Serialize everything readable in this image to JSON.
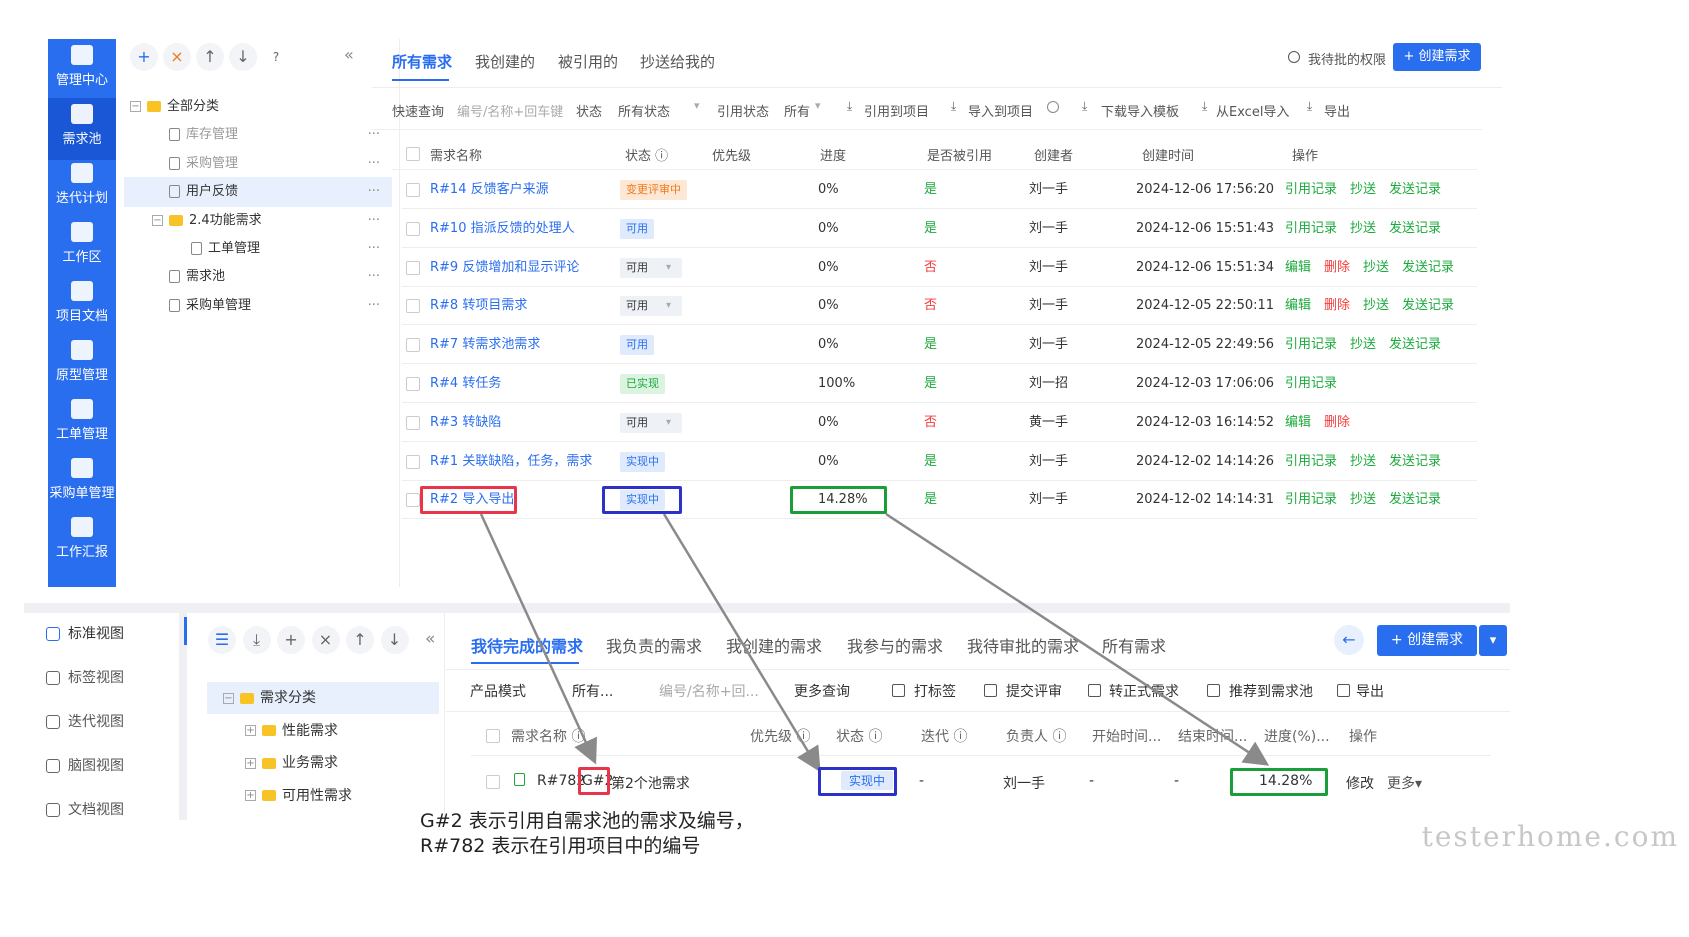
{
  "top": {
    "nav": [
      {
        "label": "管理中心",
        "icon": "monitor-icon"
      },
      {
        "label": "需求池",
        "icon": "doc-edit-icon",
        "active": true
      },
      {
        "label": "迭代计划",
        "icon": "iteration-icon"
      },
      {
        "label": "工作区",
        "icon": "briefcase-icon"
      },
      {
        "label": "项目文档",
        "icon": "document-icon"
      },
      {
        "label": "原型管理",
        "icon": "prototype-icon"
      },
      {
        "label": "工单管理",
        "icon": "ticket-icon"
      },
      {
        "label": "采购单管理",
        "icon": "purchase-icon"
      },
      {
        "label": "工作汇报",
        "icon": "mail-icon"
      }
    ],
    "toolbar_icons": [
      "+",
      "×",
      "↑",
      "↓",
      "?"
    ],
    "collapse": "«",
    "tree": [
      {
        "label": "全部分类",
        "type": "folder",
        "level": 0,
        "expand": "−"
      },
      {
        "label": "库存管理",
        "type": "doc",
        "level": 1,
        "muted": true
      },
      {
        "label": "采购管理",
        "type": "doc",
        "level": 1,
        "muted": true
      },
      {
        "label": "用户反馈",
        "type": "doc",
        "level": 1,
        "selected": true
      },
      {
        "label": "2.4功能需求",
        "type": "folder",
        "level": 1,
        "expand": "−"
      },
      {
        "label": "工单管理",
        "type": "doc",
        "level": 2
      },
      {
        "label": "需求池",
        "type": "doc",
        "level": 1
      },
      {
        "label": "采购单管理",
        "type": "doc",
        "level": 1
      }
    ],
    "tabs": [
      "所有需求",
      "我创建的",
      "被引用的",
      "抄送给我的"
    ],
    "permission": "我待批的权限",
    "create": "+ 创建需求",
    "filters": {
      "quick": "快速查询",
      "search_placeholder": "编号/名称+回车键",
      "status_label": "状态",
      "status_value": "所有状态",
      "ref_label": "引用状态",
      "ref_value": "所有",
      "cite": "引用到项目",
      "import_project": "导入到项目",
      "download_tpl": "下载导入模板",
      "excel": "从Excel导入",
      "export": "导出"
    },
    "columns": [
      "需求名称",
      "状态 ⓘ",
      "优先级",
      "进度",
      "是否被引用",
      "创建者",
      "创建时间",
      "操作"
    ],
    "rows": [
      {
        "name": "R#14 反馈客户来源",
        "status": "变更评审中",
        "status_color": "orange",
        "drop": false,
        "progress": "0%",
        "ref": "是",
        "creator": "刘一手",
        "time": "2024-12-06 17:56:20",
        "ops": [
          "引用记录",
          "抄送",
          "发送记录"
        ]
      },
      {
        "name": "R#10 指派反馈的处理人",
        "status": "可用",
        "status_color": "blue",
        "drop": false,
        "progress": "0%",
        "ref": "是",
        "creator": "刘一手",
        "time": "2024-12-06 15:51:43",
        "ops": [
          "引用记录",
          "抄送",
          "发送记录"
        ]
      },
      {
        "name": "R#9 反馈增加和显示评论",
        "status": "可用",
        "status_color": "drop",
        "drop": true,
        "progress": "0%",
        "ref": "否",
        "creator": "刘一手",
        "time": "2024-12-06 15:51:34",
        "ops": [
          "编辑",
          "删除",
          "抄送",
          "发送记录"
        ]
      },
      {
        "name": "R#8 转项目需求",
        "status": "可用",
        "status_color": "drop",
        "drop": true,
        "progress": "0%",
        "ref": "否",
        "creator": "刘一手",
        "time": "2024-12-05 22:50:11",
        "ops": [
          "编辑",
          "删除",
          "抄送",
          "发送记录"
        ]
      },
      {
        "name": "R#7 转需求池需求",
        "status": "可用",
        "status_color": "blue",
        "drop": false,
        "progress": "0%",
        "ref": "是",
        "creator": "刘一手",
        "time": "2024-12-05 22:49:56",
        "ops": [
          "引用记录",
          "抄送",
          "发送记录"
        ]
      },
      {
        "name": "R#4 转任务",
        "status": "已实现",
        "status_color": "green",
        "drop": false,
        "progress": "100%",
        "ref": "是",
        "creator": "刘一招",
        "time": "2024-12-03 17:06:06",
        "ops": [
          "引用记录"
        ]
      },
      {
        "name": "R#3 转缺陷",
        "status": "可用",
        "status_color": "drop",
        "drop": true,
        "progress": "0%",
        "ref": "否",
        "creator": "黄一手",
        "time": "2024-12-03 16:14:52",
        "ops": [
          "编辑",
          "删除"
        ]
      },
      {
        "name": "R#1 关联缺陷，任务，需求",
        "status": "实现中",
        "status_color": "blue",
        "drop": false,
        "progress": "0%",
        "ref": "是",
        "creator": "刘一手",
        "time": "2024-12-02 14:14:26",
        "ops": [
          "引用记录",
          "抄送",
          "发送记录"
        ]
      },
      {
        "name": "R#2 导入导出",
        "status": "实现中",
        "status_color": "blue",
        "drop": false,
        "progress": "14.28%",
        "ref": "是",
        "creator": "刘一手",
        "time": "2024-12-02 14:14:31",
        "ops": [
          "引用记录",
          "抄送",
          "发送记录"
        ]
      }
    ]
  },
  "bottom": {
    "views": [
      {
        "label": "标准视图",
        "icon": "standard-view-icon",
        "active": true
      },
      {
        "label": "标签视图",
        "icon": "tag-view-icon"
      },
      {
        "label": "迭代视图",
        "icon": "iteration-view-icon"
      },
      {
        "label": "脑图视图",
        "icon": "mindmap-view-icon"
      },
      {
        "label": "文档视图",
        "icon": "doc-view-icon"
      }
    ],
    "toolbar_icons": [
      "☰",
      "⤓",
      "+",
      "×",
      "↑",
      "↓"
    ],
    "collapse": "«",
    "tree": [
      {
        "label": "需求分类",
        "level": 0,
        "expand": "−",
        "selected": true
      },
      {
        "label": "性能需求",
        "level": 1,
        "expand": "+"
      },
      {
        "label": "业务需求",
        "level": 1,
        "expand": "+"
      },
      {
        "label": "可用性需求",
        "level": 1,
        "expand": "+"
      }
    ],
    "tabs": [
      "我待完成的需求",
      "我负责的需求",
      "我创建的需求",
      "我参与的需求",
      "我待审批的需求",
      "所有需求"
    ],
    "back": "←",
    "create": "+ 创建需求",
    "create_drop": "▾",
    "filters": {
      "mode": "产品模式",
      "all": "所有...",
      "search_placeholder": "编号/名称+回...",
      "more": "更多查询",
      "tag": "打标签",
      "review": "提交评审",
      "formal": "转正式需求",
      "recommend": "推荐到需求池",
      "export": "导出"
    },
    "columns": [
      "需求名称 ⓘ",
      "优先级 ⓘ",
      "状态 ⓘ",
      "迭代 ⓘ",
      "负责人 ⓘ",
      "开始时间...",
      "结束时间...",
      "进度(%)...",
      "操作"
    ],
    "row": {
      "name_prefix": "R#782",
      "name_ref": "G#2",
      "name_rest": "第2个池需求",
      "status": "实现中",
      "iteration": "-",
      "owner": "刘一手",
      "start": "-",
      "end": "-",
      "progress": "14.28%",
      "edit": "修改",
      "more": "更多▾"
    }
  },
  "annotations": {
    "line1": "G#2 表示引用自需求池的需求及编号，",
    "line2": "R#782 表示在引用项目中的编号",
    "colors": {
      "red": "#e8354a",
      "blue": "#2b31c9",
      "green": "#1a9e3a",
      "arrow": "#8a8a8a"
    }
  },
  "watermark": "testerhome.com"
}
